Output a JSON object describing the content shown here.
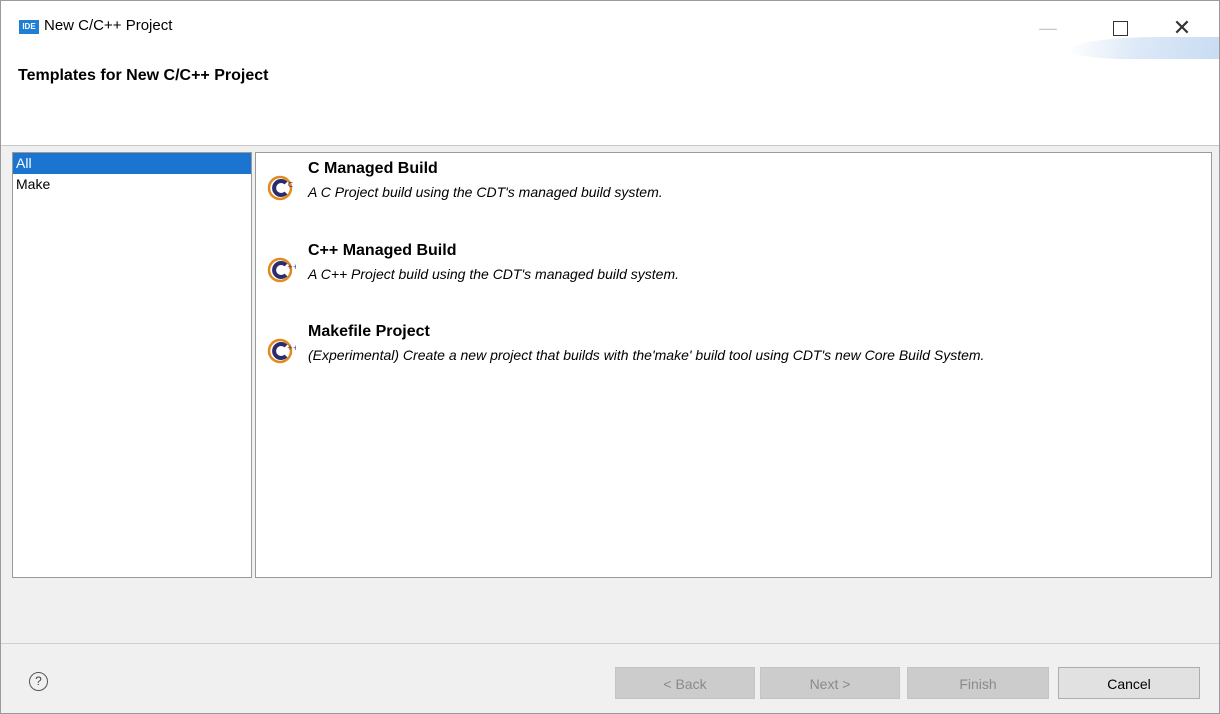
{
  "window": {
    "app_icon_text": "IDE",
    "title": "New C/C++ Project"
  },
  "header": {
    "title": "Templates for New C/C++ Project"
  },
  "categories": [
    {
      "label": "All",
      "selected": true
    },
    {
      "label": "Make",
      "selected": false
    }
  ],
  "templates": [
    {
      "name": "C Managed Build",
      "description": "A C Project build using the CDT's managed build system.",
      "icon": "cdt-c-icon"
    },
    {
      "name": "C++ Managed Build",
      "description": "A C++ Project build using the CDT's managed build system.",
      "icon": "cdt-cpp-icon"
    },
    {
      "name": "Makefile Project",
      "description": "(Experimental) Create a new project that builds with the'make' build tool using CDT's new Core Build System.",
      "icon": "cdt-make-icon"
    }
  ],
  "buttons": {
    "back": "< Back",
    "next": "Next >",
    "finish": "Finish",
    "cancel": "Cancel"
  },
  "help_icon_glyph": "?",
  "colors": {
    "selection": "#1b75d0",
    "icon_accent": "#2b2b6e"
  }
}
